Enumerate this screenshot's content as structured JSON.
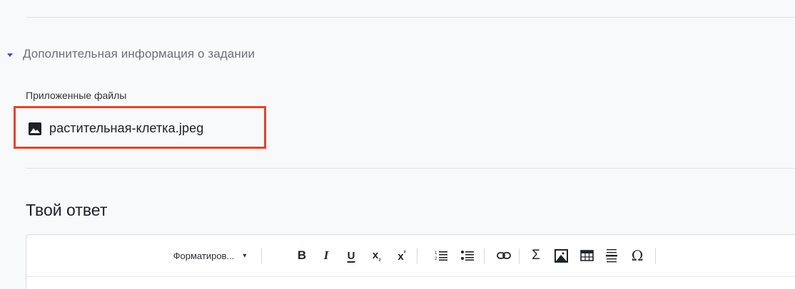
{
  "section": {
    "title": "Дополнительная информация о задании",
    "expanded": true,
    "accent_color": "#5b3ddb"
  },
  "attachments": {
    "label": "Приложенные файлы",
    "files": [
      {
        "name": "растительная-клетка.jpeg",
        "icon": "image-icon"
      }
    ],
    "highlight_color": "#e2452f"
  },
  "answer": {
    "title": "Твой ответ"
  },
  "toolbar": {
    "format_label": "Форматиров...",
    "format_arrow": "▾",
    "bold": "B",
    "italic": "I",
    "underline": "U",
    "subscript": "x₂",
    "superscript": "x²",
    "sum": "Σ",
    "omega": "Ω",
    "icons": [
      "format-dropdown",
      "bold-icon",
      "italic-icon",
      "underline-icon",
      "subscript-icon",
      "superscript-icon",
      "numbered-list-icon",
      "bulleted-list-icon",
      "link-icon",
      "sum-icon",
      "image-icon",
      "table-icon",
      "horizontal-rule-icon",
      "special-char-icon"
    ]
  }
}
